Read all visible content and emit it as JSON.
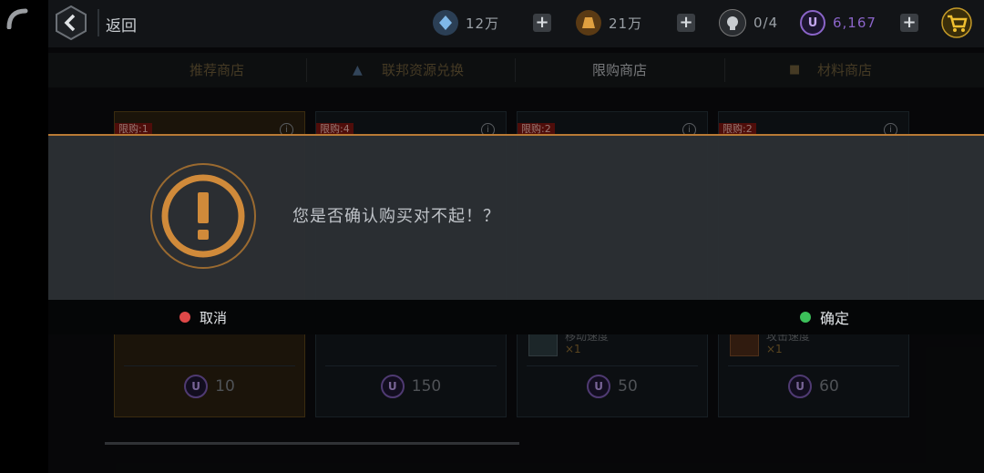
{
  "topbar": {
    "back_label": "返回",
    "resources": [
      {
        "name": "crystal",
        "value": "12万"
      },
      {
        "name": "gold",
        "value": "21万"
      },
      {
        "name": "stamina",
        "value": "0/4"
      },
      {
        "name": "u-currency",
        "value": "6,167"
      }
    ]
  },
  "tabs": [
    {
      "label": "推荐商店",
      "active": false
    },
    {
      "label": "联邦资源兑换",
      "active": false
    },
    {
      "label": "限购商店",
      "active": true
    },
    {
      "label": "材料商店",
      "active": false
    }
  ],
  "cards": [
    {
      "limit": "限购:1",
      "item_name": "",
      "qty": "",
      "price": "10",
      "style": "gold"
    },
    {
      "limit": "限购:4",
      "item_name": "",
      "qty": "",
      "price": "150",
      "style": "blue"
    },
    {
      "limit": "限购:2",
      "item_name": "移动速度",
      "qty": "×1",
      "price": "50",
      "style": "blue"
    },
    {
      "limit": "限购:2",
      "item_name": "攻击速度",
      "qty": "×1",
      "price": "60",
      "style": "blue"
    }
  ],
  "dialog": {
    "message": "您是否确认购买对不起！？",
    "cancel_label": "取消",
    "confirm_label": "确定"
  },
  "colors": {
    "accent": "#b87a35",
    "cancel_dot": "#e04848",
    "confirm_dot": "#3cc05a",
    "u_currency": "#8a64c8"
  }
}
